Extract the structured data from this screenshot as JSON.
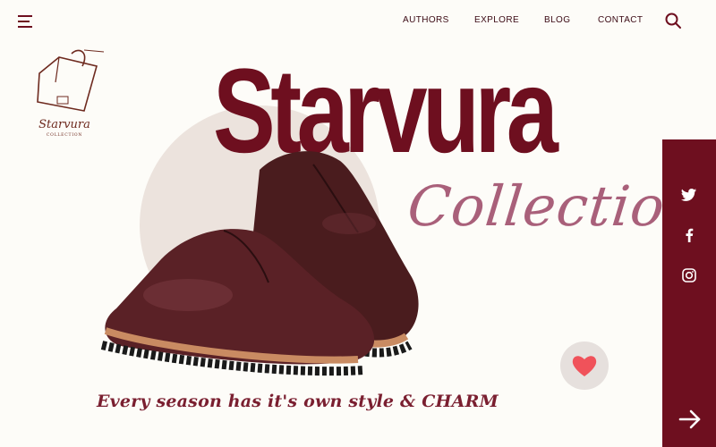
{
  "nav": {
    "items": [
      "AUTHORS",
      "EXPLORE",
      "BLOG",
      "CONTACT"
    ]
  },
  "icons": {
    "menu": "hamburger-menu-icon",
    "search": "search-icon",
    "like": "heart-icon",
    "twitter": "twitter-icon",
    "facebook": "facebook-icon",
    "instagram": "instagram-icon",
    "next": "arrow-right-icon"
  },
  "logo": {
    "name": "Starvura",
    "sub": "COLLECTION"
  },
  "hero": {
    "title": "Starvura",
    "subtitle": "Collection",
    "tagline": "Every season has it's own style & CHARM"
  },
  "colors": {
    "brand": "#6e0f1f",
    "accent_pink": "#a9607a",
    "background": "#fdfcf8",
    "circle": "#ece3dd",
    "heart": "#f0525a"
  }
}
